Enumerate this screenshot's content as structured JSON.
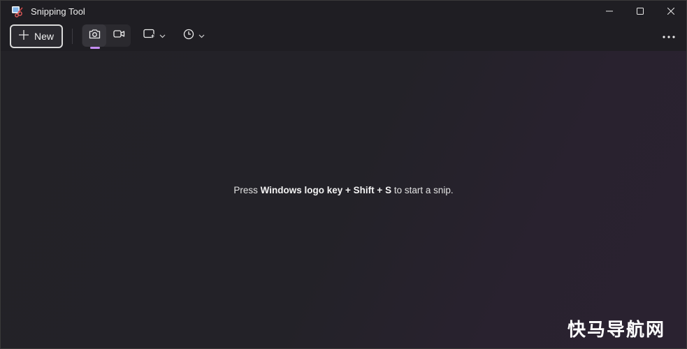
{
  "window": {
    "title": "Snipping Tool"
  },
  "toolbar": {
    "new_label": "New",
    "more_label": "⋯"
  },
  "content": {
    "hint_prefix": "Press ",
    "hint_keys_1": "Windows logo key",
    "hint_plus_1": " + ",
    "hint_keys_2": "Shift",
    "hint_plus_2": " + ",
    "hint_keys_3": "S",
    "hint_suffix": " to start a snip."
  },
  "watermark": {
    "text": "快马导航网"
  },
  "colors": {
    "accent": "#c68ef4",
    "background": "#222126",
    "text": "#e2e2e2"
  },
  "icons": {
    "app": "snipping-tool-icon",
    "minimize": "minimize-icon",
    "maximize": "maximize-icon",
    "close": "close-icon",
    "plus": "plus-icon",
    "camera": "camera-icon",
    "video": "video-camera-icon",
    "shape": "rectangle-snip-icon",
    "delay": "clock-icon",
    "chevron": "chevron-down-icon",
    "more": "more-options-icon"
  }
}
